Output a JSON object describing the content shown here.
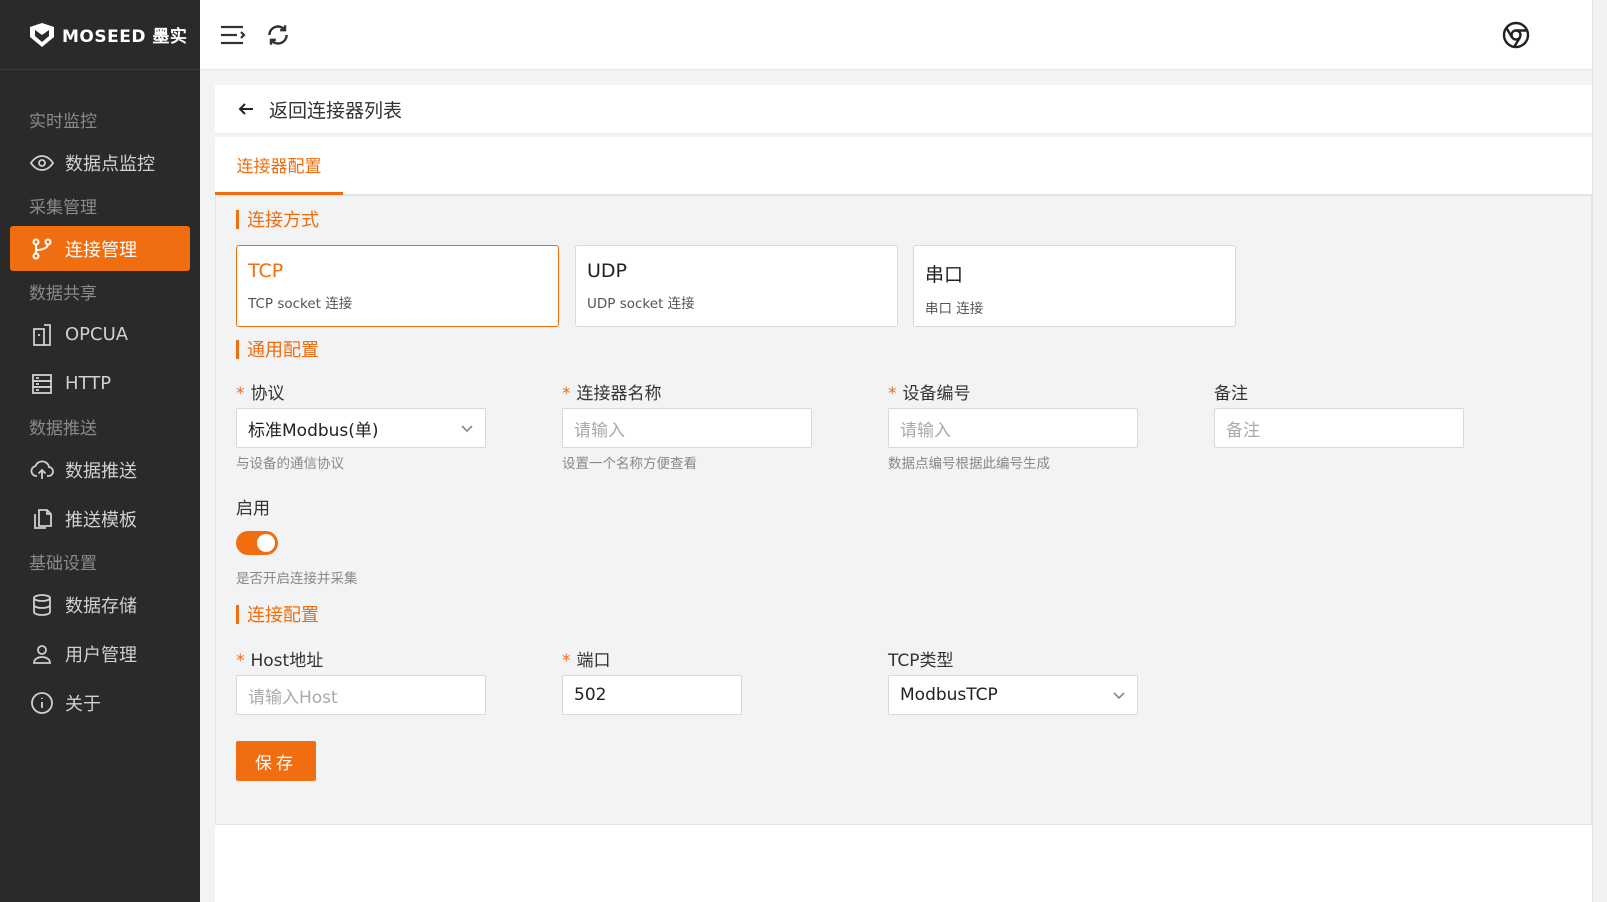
{
  "brand": {
    "name": "MOSEED 墨实"
  },
  "sidebar": {
    "sections": [
      {
        "title": "实时监控",
        "items": [
          {
            "label": "数据点监控",
            "icon": "eye-icon"
          }
        ]
      },
      {
        "title": "采集管理",
        "items": [
          {
            "label": "连接管理",
            "icon": "connection-icon",
            "active": true
          }
        ]
      },
      {
        "title": "数据共享",
        "items": [
          {
            "label": "OPCUA",
            "icon": "opcua-icon"
          },
          {
            "label": "HTTP",
            "icon": "server-icon"
          }
        ]
      },
      {
        "title": "数据推送",
        "items": [
          {
            "label": "数据推送",
            "icon": "cloud-upload-icon"
          },
          {
            "label": "推送模板",
            "icon": "copy-icon"
          }
        ]
      },
      {
        "title": "基础设置",
        "items": [
          {
            "label": "数据存储",
            "icon": "database-icon"
          },
          {
            "label": "用户管理",
            "icon": "user-icon"
          },
          {
            "label": "关于",
            "icon": "info-icon"
          }
        ]
      }
    ]
  },
  "topbar": {
    "menu_icon": "menu-icon",
    "refresh_icon": "refresh-icon",
    "chrome_icon": "chrome-icon"
  },
  "back": {
    "label": "返回连接器列表"
  },
  "tabs": [
    {
      "label": "连接器配置",
      "active": true
    }
  ],
  "connection_method": {
    "title": "连接方式",
    "options": [
      {
        "title": "TCP",
        "desc": "TCP socket 连接",
        "selected": true
      },
      {
        "title": "UDP",
        "desc": "UDP socket 连接",
        "selected": false
      },
      {
        "title": "串口",
        "desc": "串口 连接",
        "selected": false
      }
    ]
  },
  "general": {
    "title": "通用配置",
    "protocol": {
      "label": "协议",
      "required": true,
      "value": "标准Modbus(单)",
      "hint": "与设备的通信协议"
    },
    "name": {
      "label": "连接器名称",
      "required": true,
      "placeholder": "请输入",
      "hint": "设置一个名称方便查看"
    },
    "device_no": {
      "label": "设备编号",
      "required": true,
      "placeholder": "请输入",
      "hint": "数据点编号根据此编号生成"
    },
    "remark": {
      "label": "备注",
      "required": false,
      "placeholder": "备注"
    },
    "enable": {
      "label": "启用",
      "on": true,
      "hint": "是否开启连接并采集"
    }
  },
  "connection": {
    "title": "连接配置",
    "host": {
      "label": "Host地址",
      "required": true,
      "placeholder": "请输入Host"
    },
    "port": {
      "label": "端口",
      "required": true,
      "value": "502"
    },
    "tcp_type": {
      "label": "TCP类型",
      "required": false,
      "value": "ModbusTCP"
    }
  },
  "save": {
    "label": "保存"
  },
  "colors": {
    "accent": "#f06d10",
    "sidebar_bg": "#2a2a2a"
  }
}
